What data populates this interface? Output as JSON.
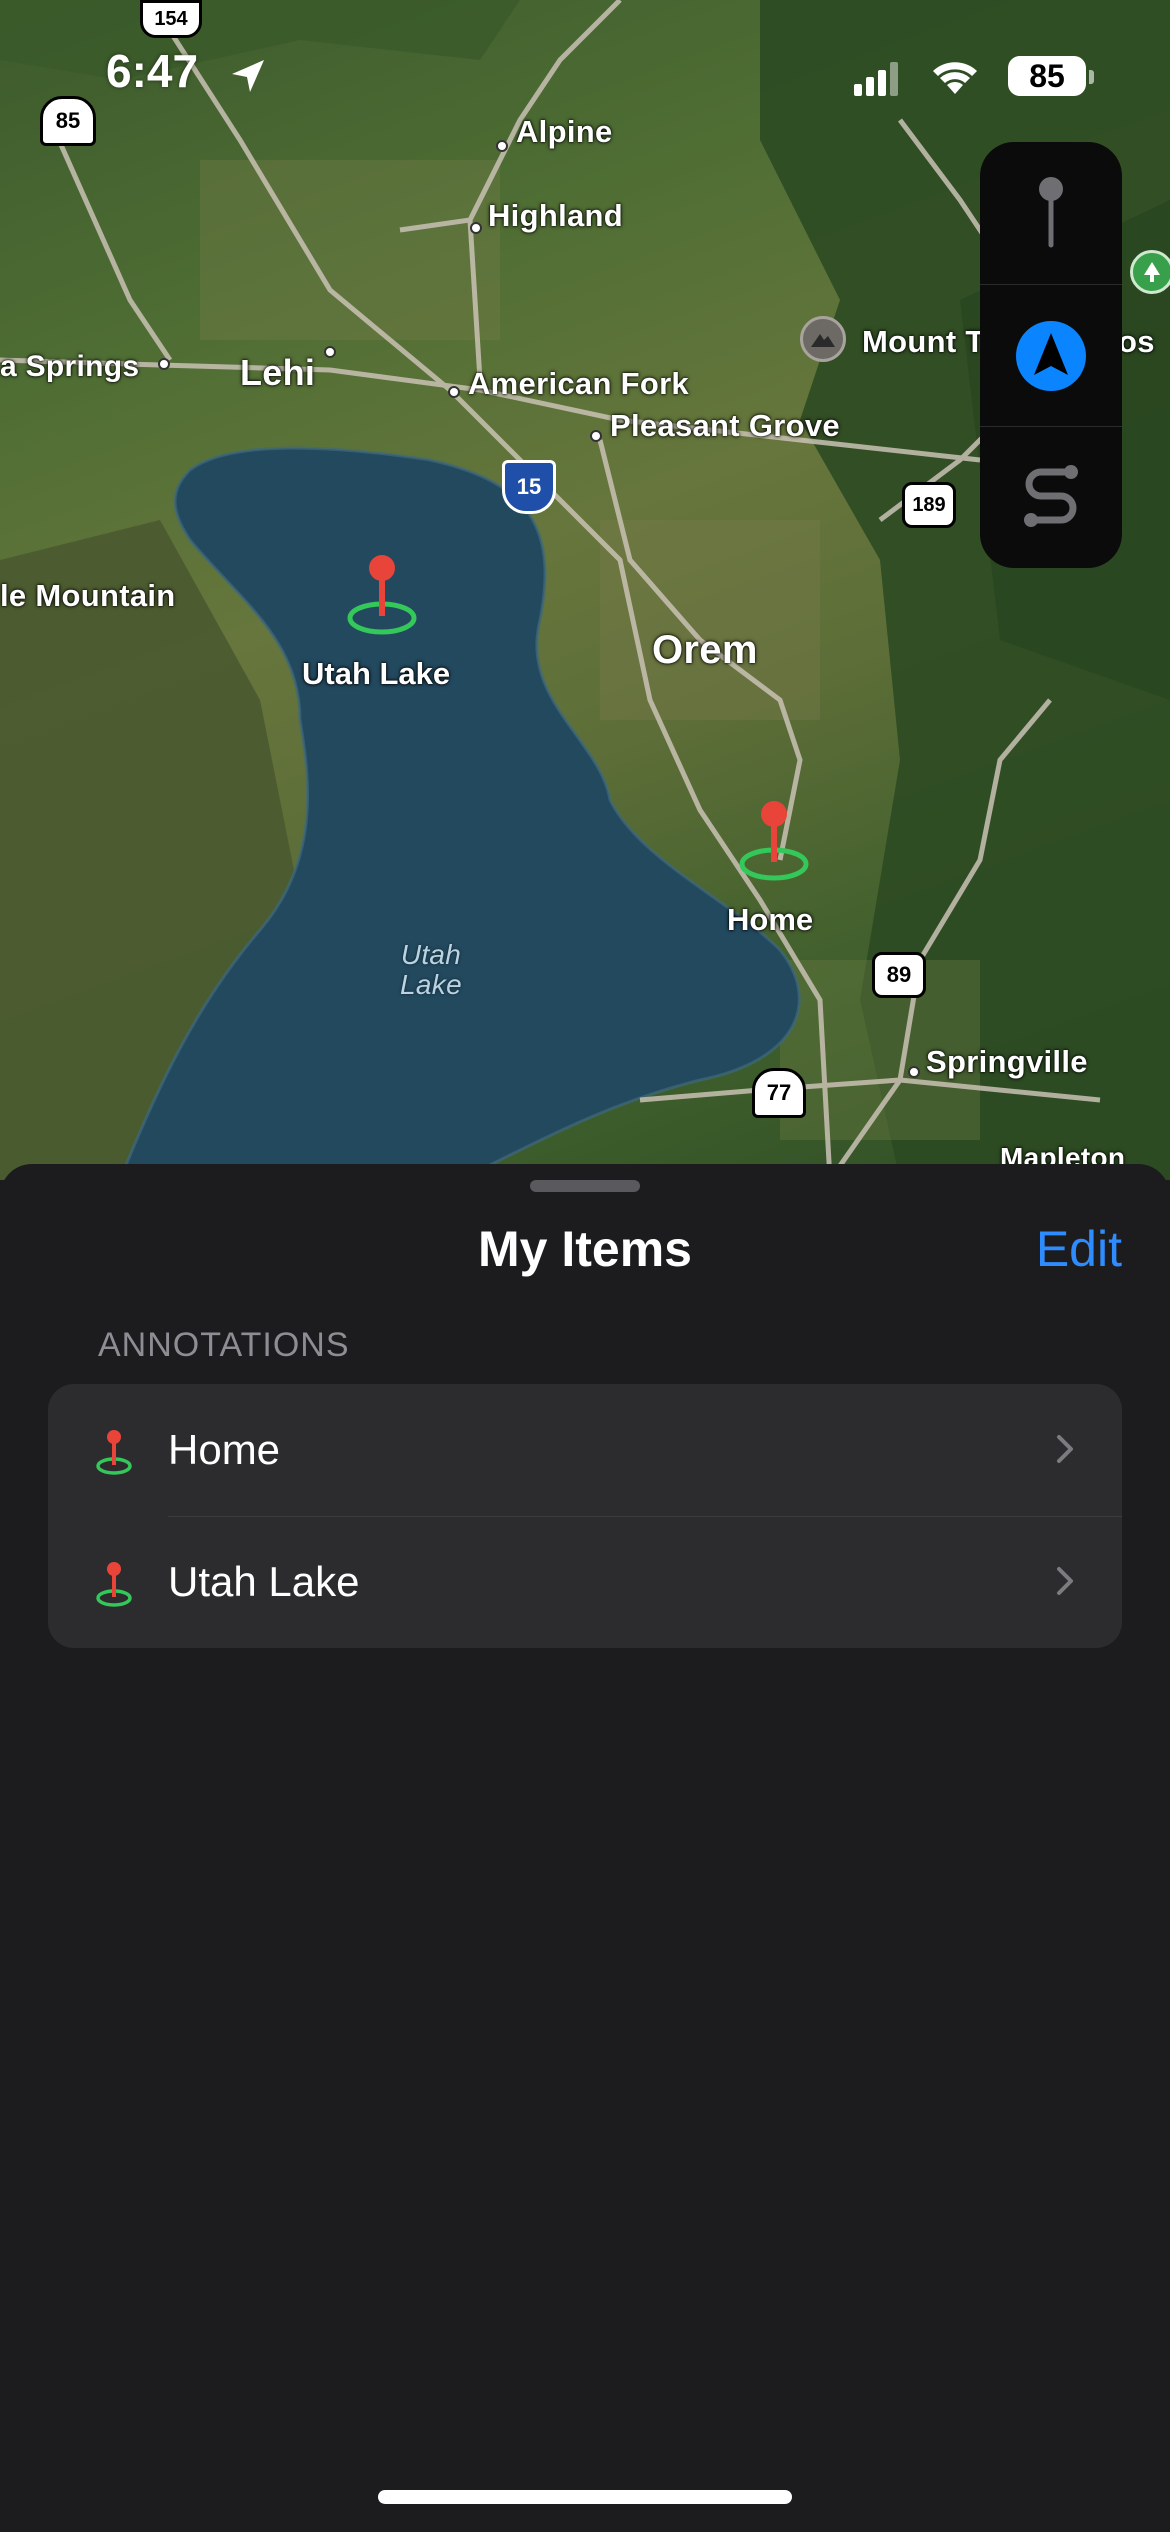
{
  "status_bar": {
    "time": "6:47",
    "battery": "85"
  },
  "map": {
    "places": {
      "alpine": "Alpine",
      "highland": "Highland",
      "springs": "a Springs",
      "lehi": "Lehi",
      "american_fork": "American Fork",
      "pleasant_grove": "Pleasant Grove",
      "mount_t": "Mount T",
      "mount_tail": "os",
      "mountain": "le Mountain",
      "orem": "Orem",
      "utah_lake_water": "Utah\nLake",
      "springville": "Springville",
      "mapleton": "Mapleton"
    },
    "shields": {
      "r154": "154",
      "r85": "85",
      "i15": "15",
      "us189": "189",
      "us89": "89",
      "r77": "77"
    },
    "annotations": [
      {
        "label": "Utah Lake"
      },
      {
        "label": "Home"
      }
    ]
  },
  "controls": {
    "icons": [
      "pin-icon",
      "navigation-arrow-icon",
      "route-icon"
    ],
    "accent": "#0a84ff"
  },
  "sheet": {
    "title": "My Items",
    "edit_label": "Edit",
    "section_header": "ANNOTATIONS",
    "items": [
      {
        "label": "Home"
      },
      {
        "label": "Utah Lake"
      }
    ]
  },
  "colors": {
    "accent": "#2f8cff",
    "pin_red": "#e8443a",
    "pin_ring": "#34c759",
    "sheet_bg": "#1c1c1e",
    "list_bg": "#2c2c2e"
  }
}
